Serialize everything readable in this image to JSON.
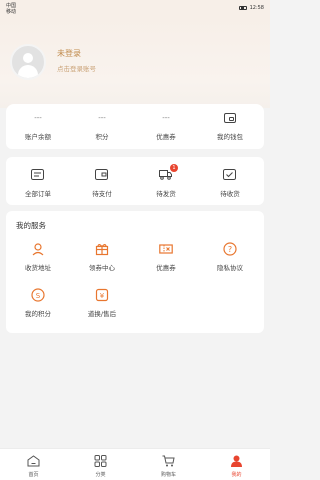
{
  "status_bar": {
    "carrier_line1": "中国",
    "carrier_line2": "移动",
    "signal": "Ⅲ Ⅲ",
    "time": "12:58"
  },
  "profile": {
    "title": "未登录",
    "subtitle": "点击登录账号"
  },
  "assets": [
    {
      "value": "---",
      "label": "账户余额"
    },
    {
      "value": "---",
      "label": "积分"
    },
    {
      "value": "---",
      "label": "优惠券"
    },
    {
      "label": "我的钱包"
    }
  ],
  "orders": [
    {
      "label": "全部订单"
    },
    {
      "label": "待支付"
    },
    {
      "label": "待发货",
      "badge": "1"
    },
    {
      "label": "待收货"
    }
  ],
  "services": {
    "title": "我的服务",
    "items": [
      {
        "label": "收货地址"
      },
      {
        "label": "领券中心"
      },
      {
        "label": "优惠券"
      },
      {
        "label": "隐私协议"
      },
      {
        "label": "我的积分"
      },
      {
        "label": "道换/售后"
      }
    ]
  },
  "bottom_nav": [
    {
      "label": "首页"
    },
    {
      "label": "分类"
    },
    {
      "label": "购物车"
    },
    {
      "label": "我的"
    }
  ],
  "colors": {
    "accent": "#e8452f",
    "gold": "#c08a4b",
    "service_icon": "#e8762f"
  }
}
